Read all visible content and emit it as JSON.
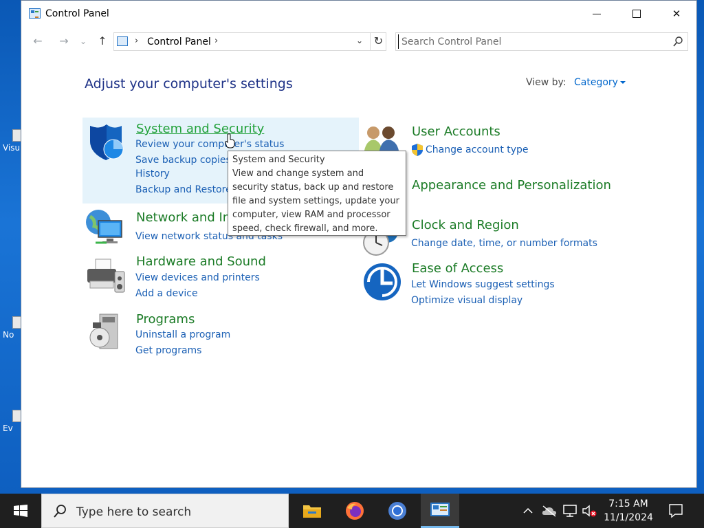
{
  "window": {
    "title": "Control Panel",
    "minimize": "–",
    "close": "✕"
  },
  "address": {
    "crumb": "Control Panel",
    "separator": "›",
    "dropdown": "⌄",
    "refresh": "↻"
  },
  "nav": {
    "back": "←",
    "forward": "→",
    "recent": "⌄",
    "up": "↑"
  },
  "search": {
    "placeholder": "Search Control Panel"
  },
  "content": {
    "heading": "Adjust your computer's settings",
    "view_by_label": "View by:",
    "view_by_value": "Category"
  },
  "left_categories": [
    {
      "title": "System and Security",
      "links": [
        "Review your computer's status",
        "Save backup copies of your files with File",
        "History",
        "Backup and Restore (Windows 7)"
      ],
      "icon": "shield-icon"
    },
    {
      "title": "Network and Internet",
      "links": [
        "View network status and tasks"
      ],
      "icon": "network-icon"
    },
    {
      "title": "Hardware and Sound",
      "links": [
        "View devices and printers",
        "Add a device"
      ],
      "icon": "printer-icon"
    },
    {
      "title": "Programs",
      "links": [
        "Uninstall a program",
        "Get programs"
      ],
      "icon": "programs-icon"
    }
  ],
  "right_categories": [
    {
      "title": "User Accounts",
      "links": [
        "Change account type"
      ],
      "icon": "users-icon"
    },
    {
      "title": "Appearance and Personalization",
      "links": [],
      "icon": "appearance-icon"
    },
    {
      "title": "Clock and Region",
      "links": [
        "Change date, time, or number formats"
      ],
      "icon": "clock-icon"
    },
    {
      "title": "Ease of Access",
      "links": [
        "Let Windows suggest settings",
        "Optimize visual display"
      ],
      "icon": "ease-of-access-icon"
    }
  ],
  "tooltip": {
    "title": "System and Security",
    "body": "View and change system and security status, back up and restore file and system settings, update your computer, view RAM and processor speed, check firewall, and more."
  },
  "desktop_icons": [
    "Visu",
    "No",
    "Ev"
  ],
  "taskbar": {
    "search_placeholder": "Type here to search",
    "time": "7:15 AM",
    "date": "11/1/2024"
  },
  "colors": {
    "category_title": "#1b7b26",
    "link": "#1a5fb4",
    "heading": "#1e3287",
    "hover_bg": "#e5f3fb"
  }
}
